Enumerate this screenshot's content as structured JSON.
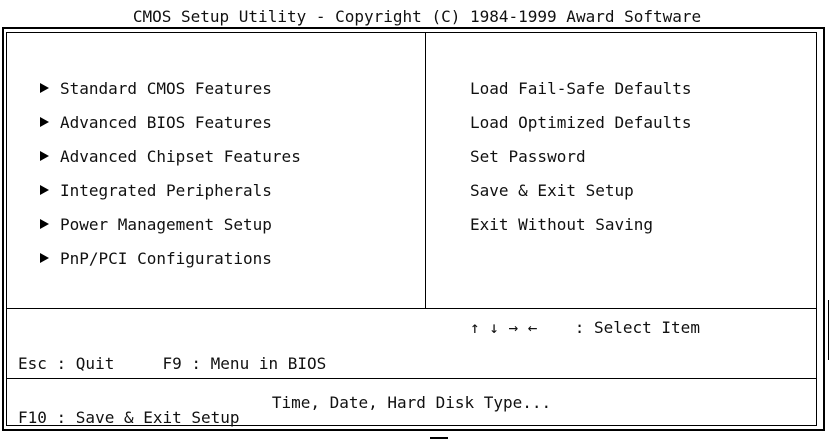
{
  "title": "CMOS Setup Utility - Copyright (C) 1984-1999 Award Software",
  "left_menu": [
    {
      "label": "Standard CMOS Features"
    },
    {
      "label": "Advanced BIOS Features"
    },
    {
      "label": "Advanced Chipset Features"
    },
    {
      "label": "Integrated Peripherals"
    },
    {
      "label": "Power Management Setup"
    },
    {
      "label": "PnP/PCI Configurations"
    }
  ],
  "right_menu": [
    {
      "label": "Load Fail-Safe Defaults"
    },
    {
      "label": "Load Optimized Defaults"
    },
    {
      "label": "Set Password"
    },
    {
      "label": "Save & Exit Setup"
    },
    {
      "label": "Exit Without Saving"
    }
  ],
  "help": {
    "line1_left": "Esc : Quit",
    "line1_mid": "F9 : Menu in BIOS",
    "line2": "F10 : Save & Exit Setup",
    "nav_keys": "↑ ↓ → ←",
    "nav_label": ": Select Item"
  },
  "status": "Time, Date, Hard Disk Type..."
}
